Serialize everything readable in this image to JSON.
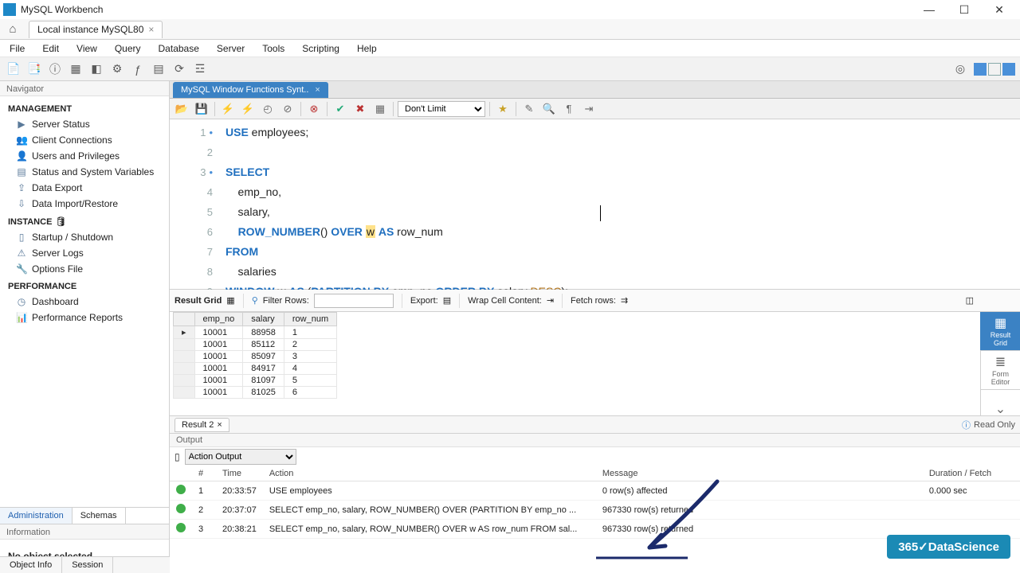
{
  "window": {
    "title": "MySQL Workbench"
  },
  "connection_tab": "Local instance MySQL80",
  "menus": [
    "File",
    "Edit",
    "View",
    "Query",
    "Database",
    "Server",
    "Tools",
    "Scripting",
    "Help"
  ],
  "navigator": {
    "title": "Navigator",
    "management_label": "MANAGEMENT",
    "management_items": [
      "Server Status",
      "Client Connections",
      "Users and Privileges",
      "Status and System Variables",
      "Data Export",
      "Data Import/Restore"
    ],
    "instance_label": "INSTANCE",
    "instance_items": [
      "Startup / Shutdown",
      "Server Logs",
      "Options File"
    ],
    "performance_label": "PERFORMANCE",
    "performance_items": [
      "Dashboard",
      "Performance Reports"
    ],
    "tabs": {
      "admin": "Administration",
      "schemas": "Schemas"
    },
    "info_title": "Information",
    "info_body": "No object selected",
    "bottom_tabs": {
      "objinfo": "Object Info",
      "session": "Session"
    }
  },
  "query_tab": {
    "label": "MySQL Window Functions Synt.."
  },
  "limit": "Don't Limit",
  "code": {
    "l1_a": "USE",
    "l1_b": " employees;",
    "l3": "SELECT",
    "l4": "    emp_no,",
    "l5": "    salary,",
    "l6_a": "    ",
    "l6_b": "ROW_NUMBER",
    "l6_c": "() ",
    "l6_d": "OVER",
    "l6_e": " ",
    "l6_w": "w",
    "l6_f": " ",
    "l6_g": "AS",
    "l6_h": " row_num",
    "l7": "FROM",
    "l8": "    salaries",
    "l9_a": "WINDOW",
    "l9_b": " w ",
    "l9_c": "AS",
    "l9_d": " (",
    "l9_e": "PARTITION BY",
    "l9_f": " emp_no ",
    "l9_g": "ORDER BY",
    "l9_h": " salary ",
    "l9_i": "DESC",
    "l9_j": ");"
  },
  "result_toolbar": {
    "grid_label": "Result Grid",
    "filter_label": "Filter Rows:",
    "export_label": "Export:",
    "wrap_label": "Wrap Cell Content:",
    "fetch_label": "Fetch rows:"
  },
  "ribbon": {
    "result": "Result\nGrid",
    "form": "Form\nEditor"
  },
  "grid": {
    "headers": [
      "emp_no",
      "salary",
      "row_num"
    ],
    "rows": [
      [
        "10001",
        "88958",
        "1"
      ],
      [
        "10001",
        "85112",
        "2"
      ],
      [
        "10001",
        "85097",
        "3"
      ],
      [
        "10001",
        "84917",
        "4"
      ],
      [
        "10001",
        "81097",
        "5"
      ],
      [
        "10001",
        "81025",
        "6"
      ]
    ]
  },
  "result_tab_label": "Result 2",
  "read_only": "Read Only",
  "output": {
    "title": "Output",
    "mode": "Action Output",
    "headers": {
      "num": "#",
      "time": "Time",
      "action": "Action",
      "message": "Message",
      "duration": "Duration / Fetch"
    },
    "rows": [
      {
        "n": "1",
        "time": "20:33:57",
        "action": "USE employees",
        "msg": "0 row(s) affected",
        "dur": "0.000 sec"
      },
      {
        "n": "2",
        "time": "20:37:07",
        "action": "SELECT   emp_no,     salary,     ROW_NUMBER() OVER (PARTITION BY emp_no ...",
        "msg": "967330 row(s) returned",
        "dur": ""
      },
      {
        "n": "3",
        "time": "20:38:21",
        "action": "SELECT   emp_no,     salary,     ROW_NUMBER() OVER w AS row_num FROM sal...",
        "msg": "967330 row(s) returned",
        "dur": ""
      }
    ]
  },
  "watermark": "365✓DataScience"
}
